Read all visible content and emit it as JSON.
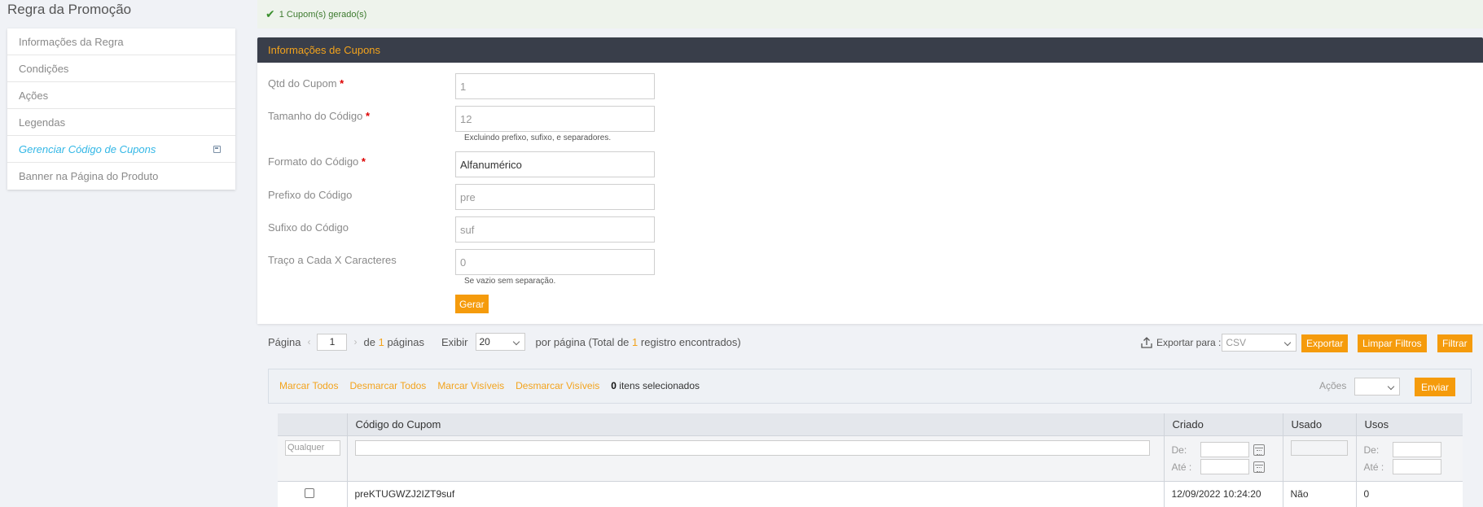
{
  "sidebar": {
    "title": "Regra da Promoção",
    "items": [
      {
        "label": "Informações da Regra"
      },
      {
        "label": "Condições"
      },
      {
        "label": "Ações"
      },
      {
        "label": "Legendas"
      },
      {
        "label": "Gerenciar Código de Cupons"
      },
      {
        "label": "Banner na Página do Produto"
      }
    ]
  },
  "message": {
    "text": "1 Cupom(s) gerado(s)"
  },
  "coupon_form": {
    "header": "Informações de Cupons",
    "qty_label": "Qtd do Cupom",
    "qty_value": "1",
    "length_label": "Tamanho do Código",
    "length_value": "12",
    "length_hint": "Excluindo prefixo, sufixo, e separadores.",
    "format_label": "Formato do Código",
    "format_value": "Alfanumérico",
    "prefix_label": "Prefixo do Código",
    "prefix_value": "pre",
    "suffix_label": "Sufixo do Código",
    "suffix_value": "suf",
    "dash_label": "Traço a Cada X Caracteres",
    "dash_value": "0",
    "dash_hint": "Se vazio sem separação.",
    "required_mark": "*",
    "generate_label": "Gerar"
  },
  "pager": {
    "page_label": "Página",
    "page_value": "1",
    "of_label": "de",
    "total_pages": "1",
    "pages_label": "páginas",
    "show_label": "Exibir",
    "per_page": "20",
    "per_page_label": "por página (Total de",
    "total_records": "1",
    "records_label": "registro encontrados)"
  },
  "export": {
    "label": "Exportar para :",
    "format": "CSV",
    "export_label": "Exportar",
    "clear_label": "Limpar Filtros",
    "filter_label": "Filtrar"
  },
  "massaction": {
    "select_all": "Marcar Todos",
    "unselect_all": "Desmarcar Todos",
    "select_visible": "Marcar Visíveis",
    "unselect_visible": "Desmarcar Visíveis",
    "selected_count": "0",
    "selected_label": "itens selecionados",
    "actions_label": "Ações",
    "submit_label": "Enviar"
  },
  "grid": {
    "columns": [
      "",
      "Código do Cupom",
      "Criado",
      "Usado",
      "Usos"
    ],
    "filter": {
      "any_option": "Qualquer",
      "from_label": "De:",
      "to_label": "Até :"
    },
    "rows": [
      {
        "code": "preKTUGWZJ2IZT9suf",
        "created": "12/09/2022 10:24:20",
        "used": "Não",
        "uses": "0"
      }
    ]
  }
}
